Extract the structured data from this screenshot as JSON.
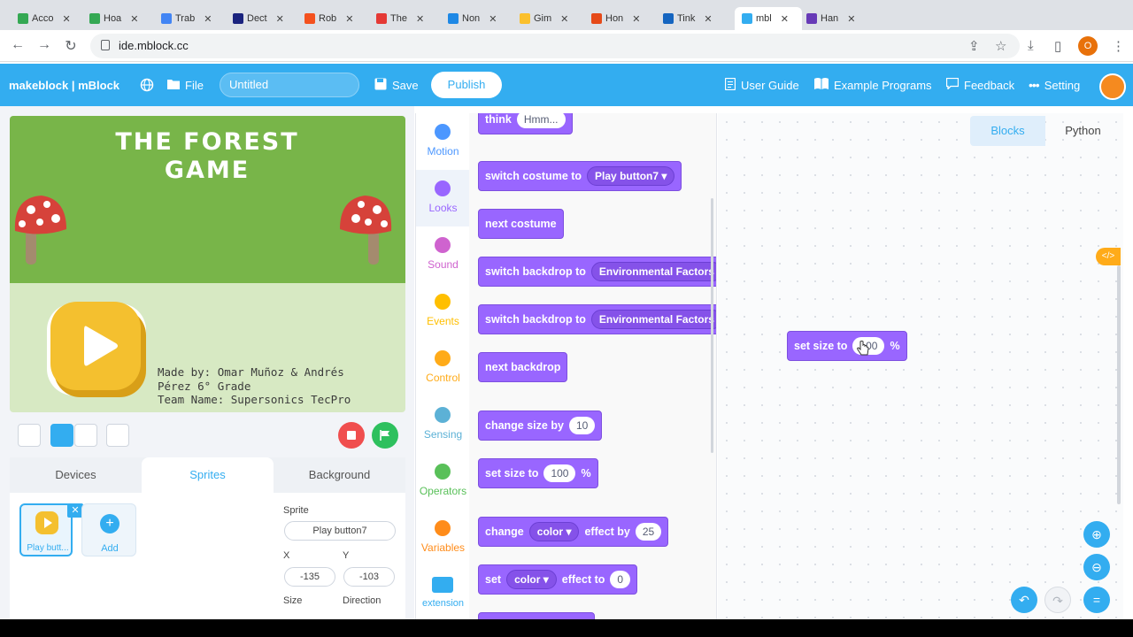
{
  "browser": {
    "url": "ide.mblock.cc",
    "tabs": [
      {
        "label": "Acco",
        "color": "#34a853"
      },
      {
        "label": "Hoa",
        "color": "#34a853"
      },
      {
        "label": "Trab",
        "color": "#4285f4"
      },
      {
        "label": "Dect",
        "color": "#1a237e"
      },
      {
        "label": "Rob",
        "color": "#f4511e"
      },
      {
        "label": "The",
        "color": "#e53935"
      },
      {
        "label": "Non",
        "color": "#1e88e5"
      },
      {
        "label": "Gim",
        "color": "#fbc02d"
      },
      {
        "label": "Hon",
        "color": "#e64a19"
      },
      {
        "label": "Tink",
        "color": "#1565c0"
      },
      {
        "label": "mbl",
        "color": "#33adf0"
      },
      {
        "label": "Han",
        "color": "#673ab7"
      }
    ],
    "profile_initial": "O"
  },
  "header": {
    "brand": "makeblock | mBlock",
    "file_label": "File",
    "project_title": "Untitled",
    "save_label": "Save",
    "publish_label": "Publish",
    "user_guide": "User Guide",
    "example_programs": "Example Programs",
    "feedback": "Feedback",
    "setting": "Setting"
  },
  "stage": {
    "game_title_line1": "THE FOREST",
    "game_title_line2": "GAME",
    "credit_line1": "Made by: Omar Muñoz & Andrés",
    "credit_line2": "Pérez 6° Grade",
    "credit_line3": "Team Name: Supersonics TecPro"
  },
  "sprite_panel": {
    "tabs": [
      "Devices",
      "Sprites",
      "Background"
    ],
    "active_tab": "Sprites",
    "sprite_thumb_label": "Play butt...",
    "add_label": "Add",
    "sprite_label": "Sprite",
    "sprite_name": "Play button7",
    "x_label": "X",
    "x_value": "-135",
    "y_label": "Y",
    "y_value": "-103",
    "size_label": "Size",
    "direction_label": "Direction"
  },
  "categories": [
    {
      "label": "Motion",
      "color": "#4c97ff"
    },
    {
      "label": "Looks",
      "color": "#9966ff"
    },
    {
      "label": "Sound",
      "color": "#cf63cf"
    },
    {
      "label": "Events",
      "color": "#ffbf00"
    },
    {
      "label": "Control",
      "color": "#ffab19"
    },
    {
      "label": "Sensing",
      "color": "#5cb1d6"
    },
    {
      "label": "Operators",
      "color": "#59c059"
    },
    {
      "label": "Variables",
      "color": "#ff8c1a"
    },
    {
      "label": "extension",
      "color": "#33adf0"
    }
  ],
  "blocks": {
    "think": {
      "label": "think",
      "value": "Hmm..."
    },
    "switch_costume": {
      "label": "switch costume to",
      "value": "Play button7 ▾"
    },
    "next_costume": {
      "label": "next costume"
    },
    "switch_backdrop_1": {
      "label": "switch backdrop to",
      "value": "Environmental Factors"
    },
    "switch_backdrop_2": {
      "label": "switch backdrop to",
      "value": "Environmental Factors"
    },
    "next_backdrop": {
      "label": "next backdrop"
    },
    "change_size": {
      "label": "change size by",
      "value": "10"
    },
    "set_size": {
      "label": "set size to",
      "value": "100",
      "unit": "%"
    },
    "change_effect": {
      "label": "change",
      "effect": "color ▾",
      "label2": "effect by",
      "value": "25"
    },
    "set_effect": {
      "label": "set",
      "effect": "color ▾",
      "label2": "effect to",
      "value": "0"
    }
  },
  "workspace": {
    "tab_blocks": "Blocks",
    "tab_python": "Python",
    "code_toggle": "</>",
    "block_label": "set size to",
    "block_value": "100",
    "block_unit": "%"
  }
}
